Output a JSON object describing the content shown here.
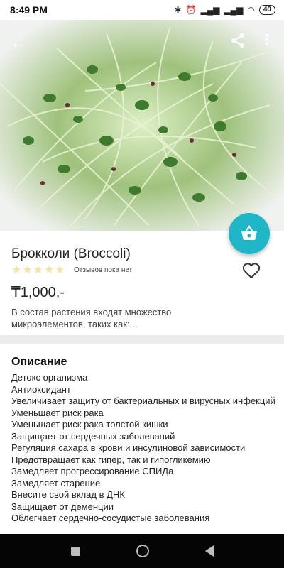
{
  "status_bar": {
    "time": "8:49 PM",
    "battery": "40",
    "icons": [
      "bluetooth-icon",
      "alarm-icon",
      "signal-icon",
      "signal-icon",
      "wifi-icon",
      "battery-icon"
    ]
  },
  "toolbar": {
    "back_icon": "arrow-left-icon",
    "share_icon": "share-icon",
    "more_icon": "more-vert-icon"
  },
  "product": {
    "title": "Брокколи (Broccoli)",
    "rating_stars": 0,
    "max_stars": 5,
    "reviews_text": "Отзывов пока нет",
    "price": "₸1,000,-",
    "short_description": "В состав растения входят множество микроэлементов, таких как:..."
  },
  "fab": {
    "icon": "basket-icon"
  },
  "favorite": {
    "icon": "heart-outline-icon"
  },
  "description": {
    "title": "Описание",
    "items": [
      "Детокс организма",
      "Антиоксидант",
      "Увеличивает защиту от бактериальных и вирусных инфекций",
      "Уменьшает риск рака",
      "Уменьшает риск рака толстой кишки",
      "Защищает от сердечных заболеваний",
      "Регуляция сахара в крови и инсулиновой зависимости",
      "Предотвращает как гипер, так и гипогликемию",
      "Замедляет прогрессирование СПИДа",
      "Замедляет старение",
      "Внесите свой вклад в ДНК",
      "Защищает от деменции",
      "Облегчает сердечно-сосудистые заболевания"
    ]
  },
  "nav": {
    "icons": [
      "recents-square-icon",
      "home-circle-icon",
      "back-triangle-icon"
    ]
  },
  "colors": {
    "accent": "#1fb7c8",
    "star_empty": "#f4e2a8",
    "divider": "#ececec"
  }
}
